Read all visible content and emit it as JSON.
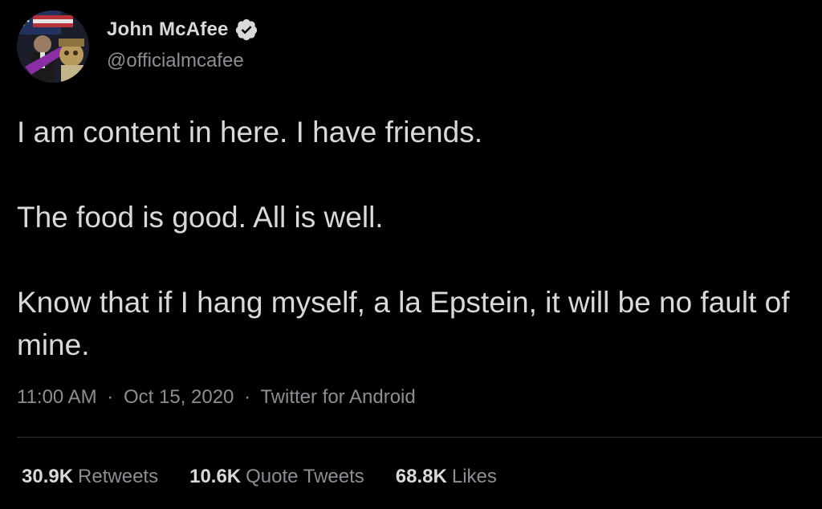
{
  "author": {
    "display_name": "John McAfee",
    "handle": "@officialmcafee",
    "verified_icon": "verified-badge-icon",
    "avatar_icon": "avatar-image"
  },
  "tweet": {
    "paragraphs": [
      "I am content in here. I have friends.",
      "The food is good. All is well.",
      "Know that if I hang myself, a la Epstein, it will be no fault of mine."
    ],
    "time": "11:00 AM",
    "separator": "·",
    "date": "Oct 15, 2020",
    "source": "Twitter for Android"
  },
  "stats": {
    "retweets_count": "30.9K",
    "retweets_label": "Retweets",
    "quote_tweets_count": "10.6K",
    "quote_tweets_label": "Quote Tweets",
    "likes_count": "68.8K",
    "likes_label": "Likes"
  },
  "colors": {
    "background": "#000000",
    "primary_text": "#d9d9d9",
    "secondary_text": "#8b8f93",
    "divider": "#2f3336"
  }
}
